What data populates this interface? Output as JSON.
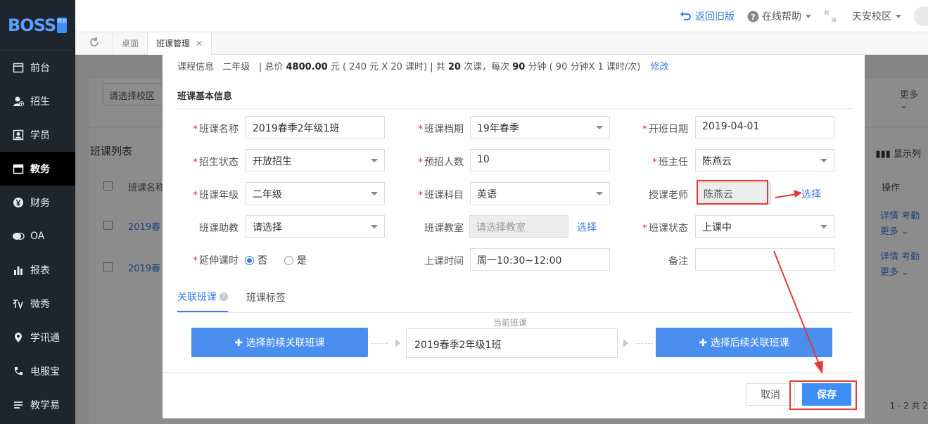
{
  "app": {
    "logo_text": "BOSS",
    "logo_badge": "校长"
  },
  "sidebar": {
    "items": [
      {
        "label": "前台",
        "icon": "calendar-icon"
      },
      {
        "label": "招生",
        "icon": "user-add-icon"
      },
      {
        "label": "学员",
        "icon": "student-card-icon"
      },
      {
        "label": "教务",
        "icon": "calendar-icon",
        "active": true
      },
      {
        "label": "财务",
        "icon": "yen-icon"
      },
      {
        "label": "OA",
        "icon": "chat-icon"
      },
      {
        "label": "报表",
        "icon": "bar-chart-icon"
      },
      {
        "label": "微秀",
        "icon": "weixiu-icon"
      },
      {
        "label": "学讯通",
        "icon": "location-icon"
      },
      {
        "label": "电服宝",
        "icon": "phone-service-icon"
      },
      {
        "label": "教学易",
        "icon": "teaching-icon"
      }
    ]
  },
  "header": {
    "back_old": "返回旧版",
    "help": "在线帮助",
    "campus": "天安校区"
  },
  "tabs": {
    "desk": "桌面",
    "class_mgmt": "班课管理"
  },
  "background": {
    "campus_select": "请选择校区",
    "more": "更多",
    "list_title": "班课列表",
    "show_columns": "显示列",
    "col_name": "班课名称",
    "col_ops": "操作",
    "row_link": "2019春",
    "op_detail": "详情",
    "op_attend": "考勤",
    "op_more": "更多",
    "pager": "1 - 2  共 2"
  },
  "modal": {
    "course_info": {
      "label": "课程信息",
      "grade": "二年级",
      "total_prefix": "| 总价",
      "total_price": "4800.00",
      "total_suffix": "元 ( 240 元 X 20 课时) | 共",
      "lesson_count": "20",
      "lesson_mid": "次课，每次",
      "minutes": "90",
      "minutes_suffix": "分钟 ( 90 分钟X 1 课时/次)",
      "edit": "修改"
    },
    "section_title": "班课基本信息",
    "fields": {
      "class_name": {
        "label": "班课名称",
        "value": "2019春季2年级1班"
      },
      "term": {
        "label": "班课档期",
        "value": "19年春季"
      },
      "start_date": {
        "label": "开班日期",
        "value": "2019-04-01"
      },
      "enroll_status": {
        "label": "招生状态",
        "value": "开放招生"
      },
      "planned_count": {
        "label": "预招人数",
        "value": "10"
      },
      "head_teacher": {
        "label": "班主任",
        "value": "陈燕云"
      },
      "grade": {
        "label": "班课年级",
        "value": "二年级"
      },
      "subject": {
        "label": "班课科目",
        "value": "英语"
      },
      "teacher": {
        "label": "授课老师",
        "value": "陈燕云",
        "select": "选择"
      },
      "assistant": {
        "label": "班课助教",
        "value": "请选择"
      },
      "classroom": {
        "label": "班课教室",
        "placeholder": "请选择教室",
        "select": "选择"
      },
      "class_status": {
        "label": "班课状态",
        "value": "上课中"
      },
      "extend": {
        "label": "延伸课时",
        "no": "否",
        "yes": "是"
      },
      "schedule": {
        "label": "上课时间",
        "value": "周一10:30~12:00"
      },
      "remark": {
        "label": "备注",
        "value": ""
      }
    },
    "subtabs": {
      "related": "关联班课",
      "tags": "班课标签"
    },
    "current_label": "当前班课",
    "select_prev": "✚ 选择前续关联班课",
    "current_class": "2019春季2年级1班",
    "select_next": "✚ 选择后续关联班课",
    "cancel": "取消",
    "save": "保存"
  }
}
